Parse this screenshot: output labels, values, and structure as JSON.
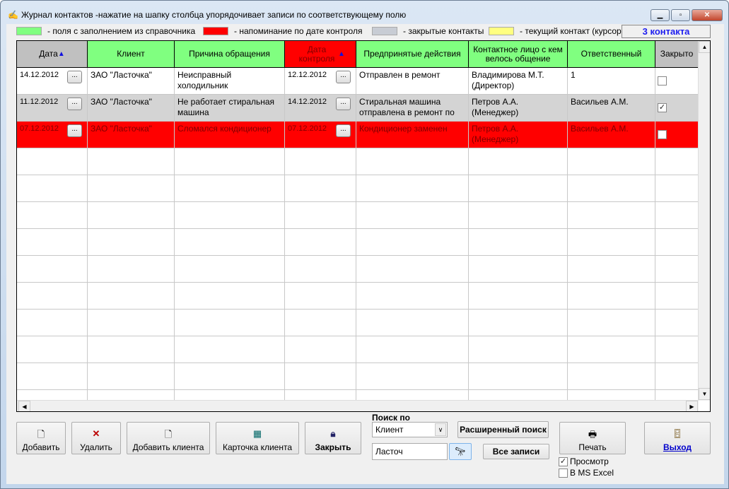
{
  "window": {
    "title": "Журнал контактов -нажатие на шапку столбца упорядочивает записи по соответствующему полю",
    "controls": [
      "minimize",
      "maximize",
      "close"
    ]
  },
  "legend": [
    {
      "label": "- поля с заполнением из справочника",
      "color": "#80ff80"
    },
    {
      "label": "- напоминание по дате контроля",
      "color": "#ff0000"
    },
    {
      "label": "- закрытые контакты",
      "color": "#c8ccd4"
    },
    {
      "label": "- текущий контакт (курсор)",
      "color": "#ffff80"
    }
  ],
  "count": "3 контакта",
  "columns": [
    {
      "label": "Дата",
      "sort": "asc",
      "bg": "#c0c0c0"
    },
    {
      "label": "Клиент",
      "bg": "#80ff80"
    },
    {
      "label": "Причина обращения",
      "bg": "#80ff80"
    },
    {
      "label": "Дата контроля",
      "sort": "asc",
      "bg": "#ff0000"
    },
    {
      "label": "Предпринятые действия",
      "bg": "#80ff80"
    },
    {
      "label": "Контактное лицо с кем велось общение",
      "bg": "#80ff80"
    },
    {
      "label": "Ответственный",
      "bg": "#80ff80"
    },
    {
      "label": "Закрыто",
      "bg": "#c0c0c0"
    }
  ],
  "rows": [
    {
      "date": "14.12.2012",
      "client": "ЗАО \"Ласточка\"",
      "reason": "Неисправный холодильник",
      "control": "12.12.2012",
      "actions": "Отправлен в ремонт",
      "contact": "Владимирова М.Т. (Директор)",
      "responsible": "1",
      "closed": false,
      "bg": "#ffffff",
      "fg": "#000000"
    },
    {
      "date": "11.12.2012",
      "client": "ЗАО \"Ласточка\"",
      "reason": "Не работает стиральная машина",
      "control": "14.12.2012",
      "actions": "Стиральная машина отправлена в ремонт по",
      "contact": "Петров А.А. (Менеджер)",
      "responsible": "Васильев А.М.",
      "closed": true,
      "bg": "#d4d4d4",
      "fg": "#000000"
    },
    {
      "date": "07.12.2012",
      "client": "ЗАО \"Ласточка\"",
      "reason": "Сломался кондиционер",
      "control": "07.12.2012",
      "actions": "Кондиционер заменен",
      "contact": "Петров А.А. (Менеджер)",
      "responsible": "Васильев А.М.",
      "closed": false,
      "bg": "#ff0000",
      "fg": "#800000"
    }
  ],
  "toolbar": {
    "add": "Добавить",
    "delete": "Удалить",
    "add_client": "Добавить клиента",
    "client_card": "Карточка клиента",
    "close": "Закрыть",
    "search_by_label": "Поиск по",
    "search_by_value": "Клиент",
    "advanced_search": "Расширенный поиск",
    "search_value": "Ласточ",
    "all_records": "Все записи",
    "print": "Печать",
    "preview": "Просмотр",
    "preview_checked": true,
    "excel": "В MS Excel",
    "excel_checked": false,
    "exit": "Выход"
  }
}
